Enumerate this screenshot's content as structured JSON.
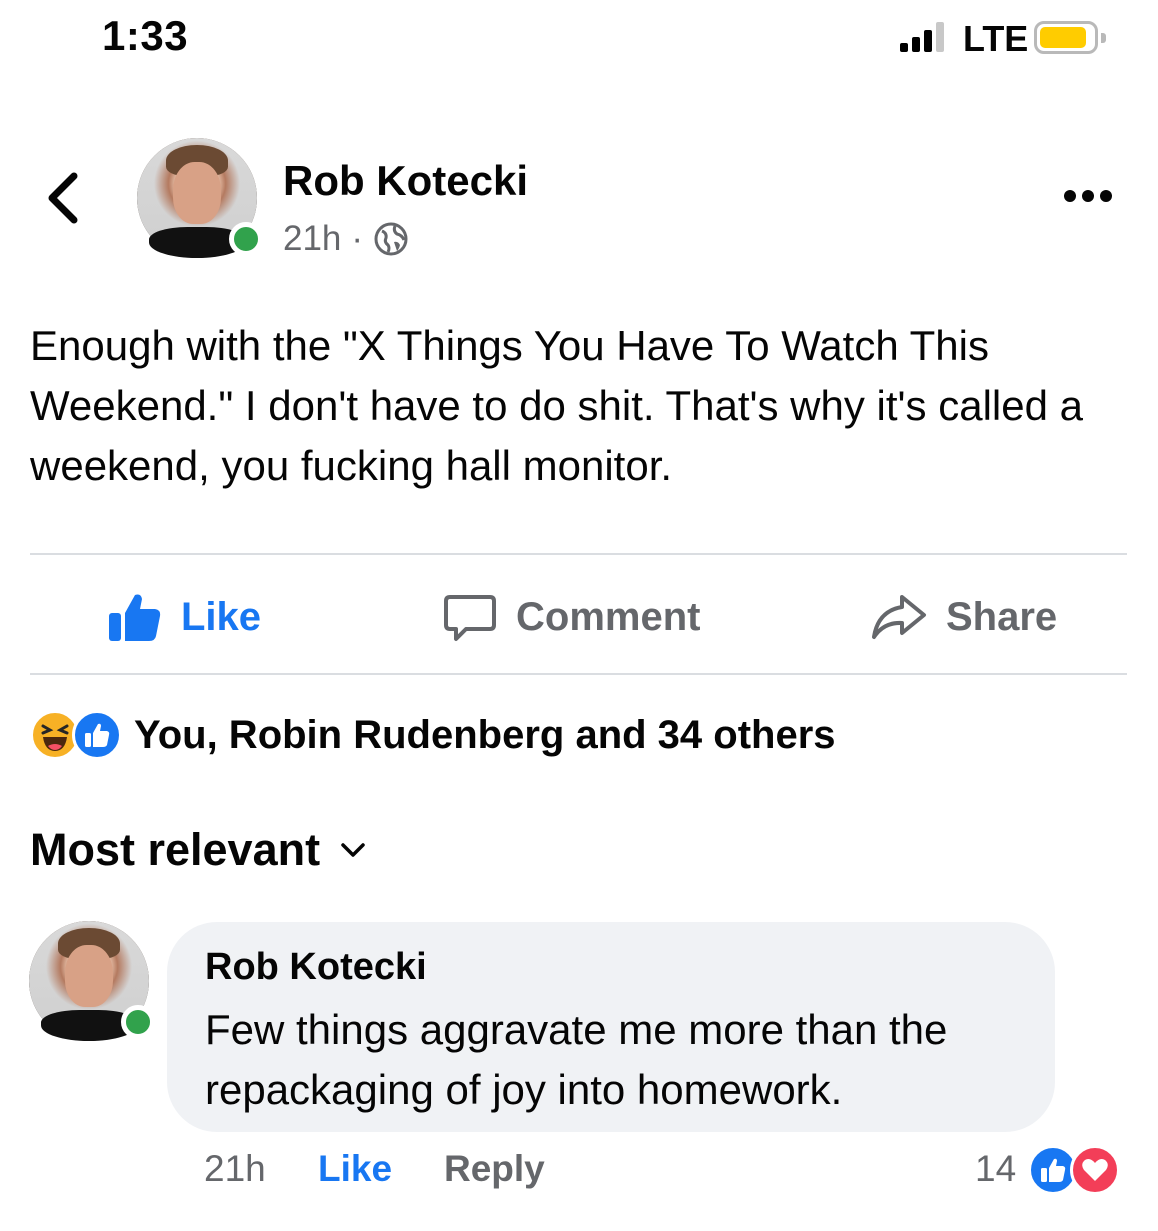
{
  "status_bar": {
    "time": "1:33",
    "network": "LTE",
    "battery_fraction": 0.8,
    "battery_color": "#ffcc00"
  },
  "post": {
    "author": "Rob Kotecki",
    "time": "21h",
    "separator": "·",
    "privacy_icon": "globe-icon",
    "text": "Enough with the \"X Things You Have To Watch This Weekend.\" I don't have to do shit. That's why it's called a weekend, you fucking hall monitor."
  },
  "actions": {
    "like": "Like",
    "comment": "Comment",
    "share": "Share"
  },
  "reactions": {
    "icons": [
      "haha-icon",
      "like-reaction-icon"
    ],
    "summary": "You, Robin Rudenberg and 34 others"
  },
  "comments_sort": {
    "label": "Most relevant"
  },
  "comment": {
    "author": "Rob Kotecki",
    "text": "Few things aggravate me more than the repackaging of joy into homework.",
    "time": "21h",
    "like": "Like",
    "reply": "Reply",
    "reaction_count": "14",
    "reaction_icons": [
      "like-reaction-icon",
      "love-reaction-icon"
    ]
  },
  "colors": {
    "accent": "#1877f2",
    "secondary_text": "#65676b",
    "online": "#31a24c",
    "bubble": "#f0f2f5"
  }
}
